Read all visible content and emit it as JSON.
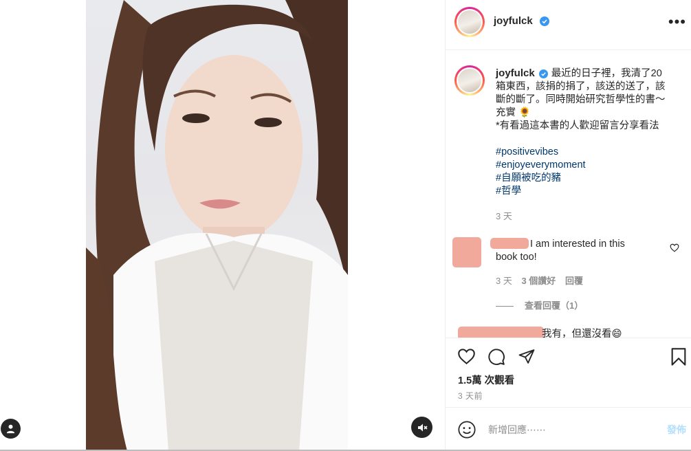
{
  "post": {
    "username": "joyfulck",
    "caption_lines": [
      "最近的日子裡，我清了20",
      "箱東西，該捐的捐了，該送的送了，該",
      "斷的斷了。同時開始研究哲學性的書～",
      "充實 🌻",
      "*有看過這本書的人歡迎留言分享看法"
    ],
    "hashtags": [
      "#positivevibes",
      "#enjoyeverymoment",
      "#自願被吃的豬",
      "#哲學"
    ],
    "caption_time": "3 天"
  },
  "comments": [
    {
      "text_line1": "I am interested in this",
      "text_line2": "book too!",
      "time": "3 天",
      "likes": "3 個讚好",
      "reply_label": "回覆",
      "view_replies": "查看回覆（1）"
    },
    {
      "text": "我有，但還沒看😄"
    }
  ],
  "stats": {
    "views": "1.5萬 次觀看",
    "posted": "3 天前"
  },
  "composer": {
    "placeholder": "新增回應⋯⋯",
    "post_label": "發佈"
  },
  "icons": {
    "verified": "verified-badge-icon",
    "more": "more-options-icon",
    "like": "heart-icon",
    "comment": "comment-icon",
    "share": "paper-plane-icon",
    "save": "bookmark-icon",
    "emoji": "emoji-icon",
    "mute": "muted-speaker-icon",
    "user_tag": "user-icon"
  },
  "colors": {
    "hashtag": "#00376b",
    "verified": "#3897f0",
    "post_disabled": "#b2dffc",
    "censor_blur": "#f1a99c"
  }
}
